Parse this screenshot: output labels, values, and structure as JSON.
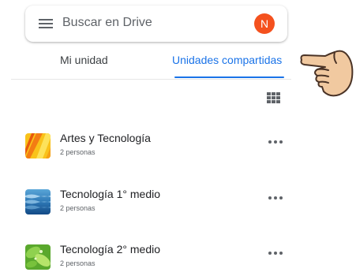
{
  "search": {
    "placeholder": "Buscar en Drive",
    "icon": "menu-icon"
  },
  "account": {
    "initial": "N",
    "color": "#f4511e"
  },
  "tabs": [
    {
      "label": "Mi unidad",
      "selected": false
    },
    {
      "label": "Unidades compartidas",
      "selected": true
    }
  ],
  "accent_color": "#1a73e8",
  "view_toggle": {
    "icon": "grid-view-icon"
  },
  "drives": [
    {
      "name": "Artes y Tecnología",
      "members": "2 personas",
      "thumbnail": "yellow-abstract"
    },
    {
      "name": "Tecnología 1° medio",
      "members": "2 personas",
      "thumbnail": "blue-water"
    },
    {
      "name": "Tecnología 2° medio",
      "members": "2 personas",
      "thumbnail": "green-leaves"
    }
  ],
  "overlay": {
    "icon": "pointing-hand-icon"
  }
}
